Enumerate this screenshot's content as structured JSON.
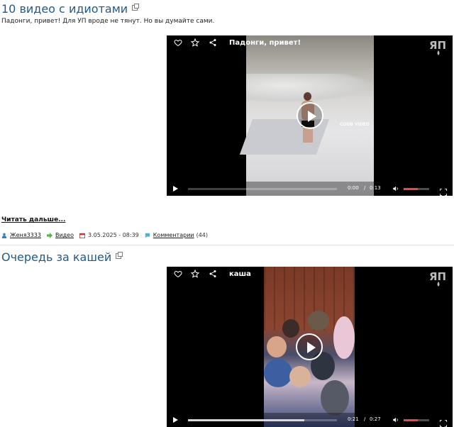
{
  "posts": [
    {
      "title": "10 видео с идиотами",
      "intro": "Падонги, привет! Для УП вроде не тянут. Но вы думайте сами.",
      "video": {
        "title": "Падонги, привет!",
        "watermark": "COUB VIDEO",
        "current_time": "0:00",
        "separator": "/",
        "duration": "0:13",
        "progress": 0.0,
        "volume": 0.55
      },
      "read_more": "Читать дальше...",
      "meta": {
        "author": "Женя3333",
        "category": "Видео",
        "date": "3.05.2025 - 08:39",
        "comments_label": "Комментарии",
        "comments_count": "(44)"
      }
    },
    {
      "title": "Очередь за кашей",
      "video": {
        "title": "каша",
        "current_time": "0:21",
        "separator": "/",
        "duration": "0:27",
        "progress": 0.78,
        "volume": 0.55
      }
    }
  ],
  "colors": {
    "title": "#1f5a8a",
    "volume_fill": "#e84a4a",
    "player_bg": "#000000"
  },
  "icons": [
    "heart-icon",
    "star-icon",
    "share-icon",
    "site-logo-icon",
    "play-icon",
    "volume-icon",
    "fullscreen-icon",
    "external-link-icon",
    "user-icon",
    "arrow-icon",
    "calendar-icon",
    "comment-icon"
  ]
}
